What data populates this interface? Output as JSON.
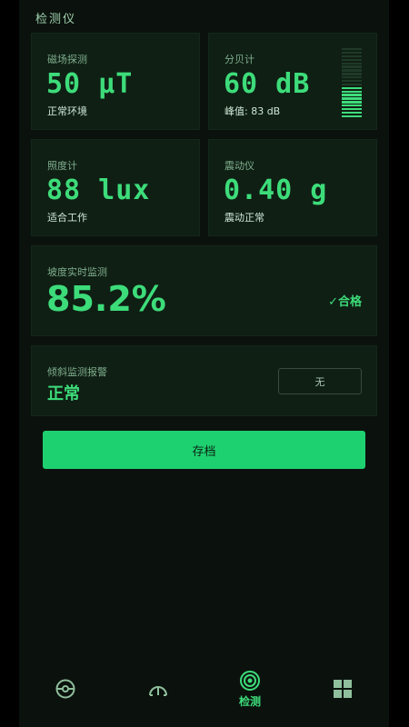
{
  "app": {
    "title": "检测仪"
  },
  "cards": {
    "magnetic": {
      "label": "磁场探测",
      "value": "50 μT",
      "status": "正常环境"
    },
    "decibel": {
      "label": "分贝计",
      "value": "60 dB",
      "peak": "峰值: 83 dB",
      "level_fraction": 0.45
    },
    "lux": {
      "label": "照度计",
      "value": "88 lux",
      "status": "适合工作"
    },
    "vibration": {
      "label": "震动仪",
      "value": "0.40 g",
      "status": "震动正常"
    },
    "slope": {
      "label": "坡度实时监测",
      "value": "85.2%",
      "result": "✓合格"
    },
    "tilt": {
      "label": "倾斜监测报警",
      "state": "正常",
      "alarm_button": "无"
    }
  },
  "save_button": "存档",
  "nav": {
    "items": [
      {
        "icon": "compass-icon",
        "label": ""
      },
      {
        "icon": "protractor-icon",
        "label": ""
      },
      {
        "icon": "radar-icon",
        "label": "检测",
        "active": true
      },
      {
        "icon": "grid-icon",
        "label": ""
      }
    ]
  },
  "colors": {
    "accent": "#3ddc7a",
    "button": "#1ed170",
    "card": "#0f1f14",
    "background": "#0b120d"
  }
}
